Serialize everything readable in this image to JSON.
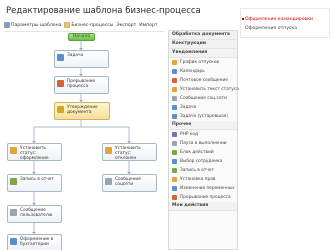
{
  "page": {
    "title": "Редактирование шаблона бизнес-процесса"
  },
  "toolbar": {
    "items": [
      {
        "label": "Параметры шаблона"
      },
      {
        "label": "Бизнес-процессы"
      },
      {
        "label": "Экспорт"
      },
      {
        "label": "Импорт"
      }
    ]
  },
  "flow": {
    "start": "Начало",
    "blocks": {
      "zadacha": "Задача",
      "prervanie": "Прерывание процесса",
      "utverzhdenie": "Утверждение документа",
      "ust_status_oformlenie": "Установить статус: оформление",
      "ust_status_otklonen": "Установить статус: отклонен",
      "zapis_v_otchet": "Запись в отчет",
      "soobshenie_1": "Сообщение соцсети",
      "soobshenie_2": "Сообщение пользователю",
      "oformlenie_buh": "Оформление в бухгалтерии"
    }
  },
  "panel": {
    "sections": [
      {
        "title": "Обработка документа",
        "items": []
      },
      {
        "title": "Конструкции",
        "items": []
      },
      {
        "title": "Уведомления",
        "items": [
          "График отпусков",
          "Календарь",
          "Почтовое сообщение",
          "Установить текст статуса",
          "Сообщение соц.сети",
          "Задача",
          "Задача (устаревшая)"
        ]
      },
      {
        "title": "Прочее",
        "items": [
          "PHP код",
          "Пауза в выполнении",
          "Блок действий",
          "Выбор сотрудника",
          "Запись в отчет",
          "Установка прав",
          "Изменение переменных",
          "Прерывание процесса"
        ]
      },
      {
        "title": "Мои действия",
        "items": []
      }
    ]
  },
  "properties": {
    "active": "Оформление командировки",
    "second": "Оформление отпуска"
  },
  "colors": {
    "accent": "#d20000",
    "start": "#6bbf4b",
    "condition": "#f4e09b"
  }
}
